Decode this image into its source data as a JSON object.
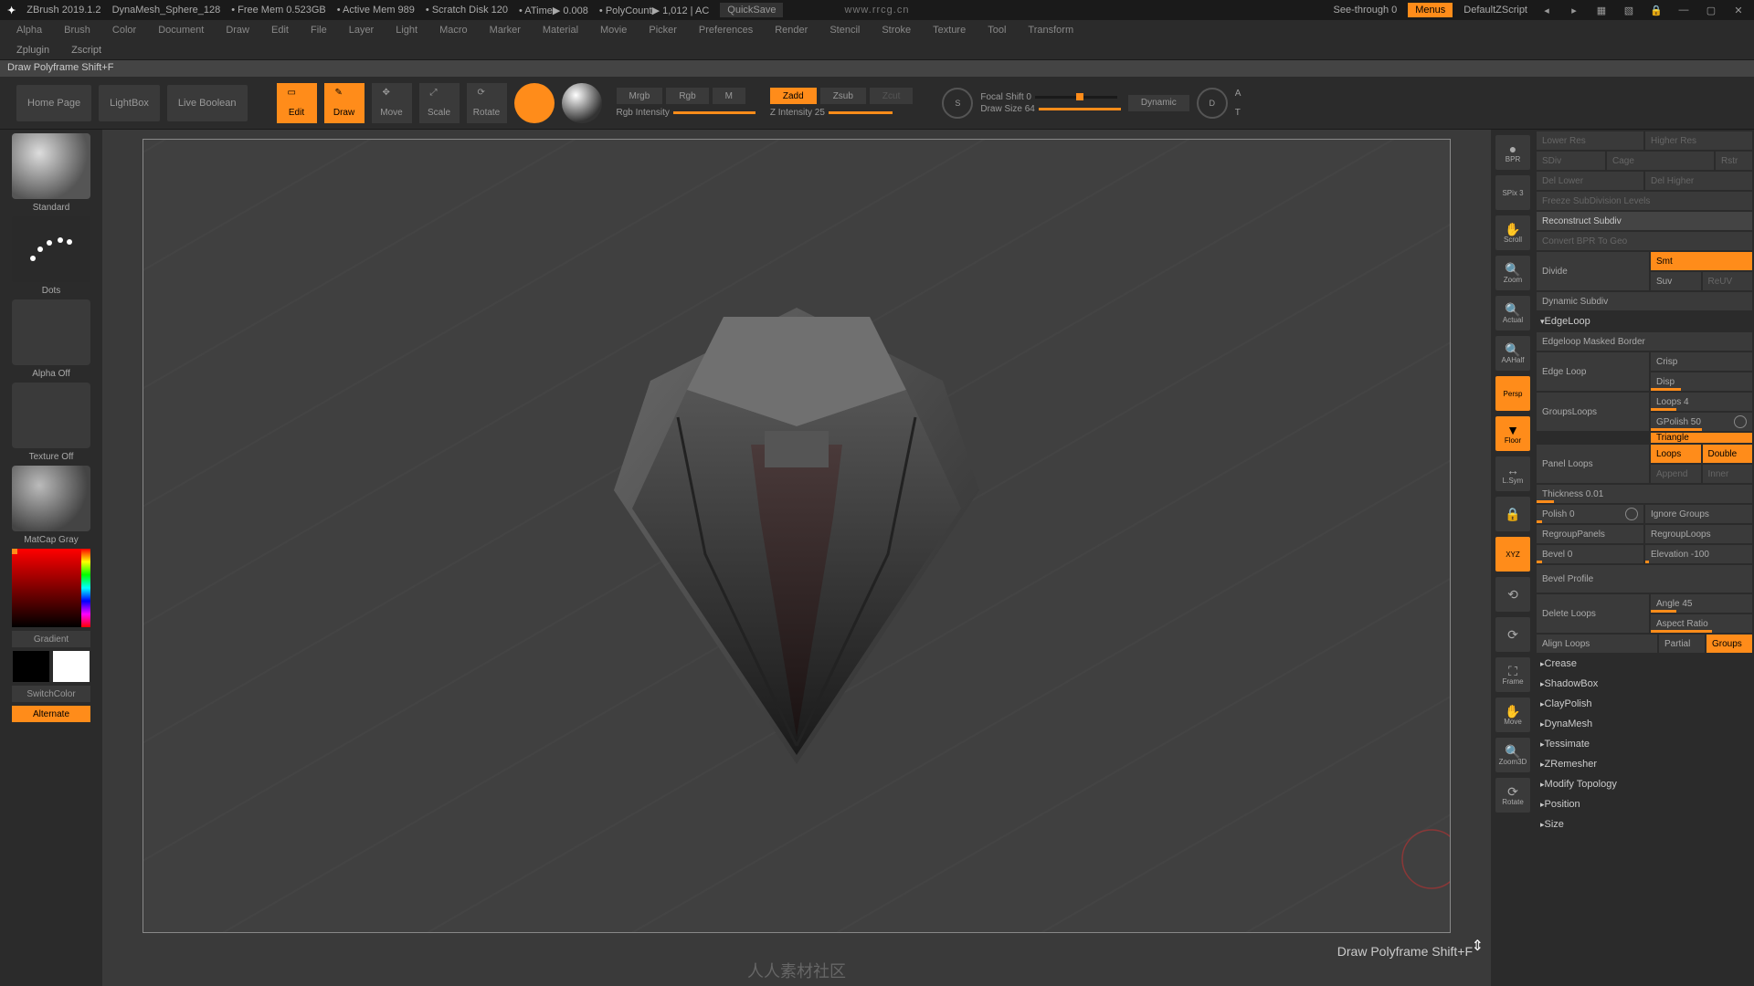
{
  "titlebar": {
    "app": "ZBrush 2019.1.2",
    "project": "DynaMesh_Sphere_128",
    "freemem": "Free Mem 0.523GB",
    "activemem": "Active Mem 989",
    "scratch": "Scratch Disk 120",
    "atime": "ATime▶ 0.008",
    "url_wm": "www.rrcg.cn",
    "polycount": "PolyCount▶ 1,012 | AC",
    "quicksave": "QuickSave",
    "seethrough": "See-through  0",
    "menus": "Menus",
    "zscript": "DefaultZScript"
  },
  "menu": {
    "items": [
      "Alpha",
      "Brush",
      "Color",
      "Document",
      "Draw",
      "Edit",
      "File",
      "Layer",
      "Light",
      "Macro",
      "Marker",
      "Material",
      "Movie",
      "Picker",
      "Preferences",
      "Render",
      "Stencil",
      "Stroke",
      "Texture",
      "Tool",
      "Transform"
    ],
    "items2": [
      "Zplugin",
      "Zscript"
    ]
  },
  "hint": "Draw Polyframe  Shift+F",
  "shelf": {
    "home": "Home Page",
    "lightbox": "LightBox",
    "liveboolean": "Live Boolean",
    "modes": [
      "Edit",
      "Draw",
      "Move",
      "Scale",
      "Rotate"
    ],
    "mrgb": "Mrgb",
    "rgb": "Rgb",
    "m": "M",
    "rgbint": "Rgb Intensity",
    "zadd": "Zadd",
    "zsub": "Zsub",
    "zcut": "Zcut",
    "zint": "Z Intensity  25",
    "focal": "Focal Shift  0",
    "drawsize": "Draw Size  64",
    "dynamic": "Dynamic",
    "a_label": "A",
    "t_label": "T",
    "s_label": "S",
    "d_label": "D"
  },
  "left": {
    "brush": "Standard",
    "stroke": "Dots",
    "alpha": "Alpha Off",
    "texture": "Texture Off",
    "material": "MatCap Gray",
    "gradient": "Gradient",
    "switch": "SwitchColor",
    "alternate": "Alternate"
  },
  "rightshelf": {
    "items": [
      {
        "label": "BPR",
        "active": false
      },
      {
        "label": "SPix 3",
        "active": false
      },
      {
        "label": "Scroll",
        "active": false
      },
      {
        "label": "Zoom",
        "active": false
      },
      {
        "label": "Actual",
        "active": false
      },
      {
        "label": "AAHalf",
        "active": false
      },
      {
        "label": "Persp",
        "active": true
      },
      {
        "label": "Floor",
        "active": true
      },
      {
        "label": "L.Sym",
        "active": false
      },
      {
        "label": "",
        "active": false
      },
      {
        "label": "XYZ",
        "active": true
      },
      {
        "label": "",
        "active": false
      },
      {
        "label": "",
        "active": false
      },
      {
        "label": "Frame",
        "active": false
      },
      {
        "label": "Move",
        "active": false
      },
      {
        "label": "Zoom3D",
        "active": false
      },
      {
        "label": "Rotate",
        "active": false
      }
    ]
  },
  "rp": {
    "lowerres": "Lower Res",
    "higherres": "Higher Res",
    "sdiv": "SDiv",
    "cage": "Cage",
    "rstr": "Rstr",
    "dellower": "Del Lower",
    "delhigher": "Del Higher",
    "freeze": "Freeze SubDivision Levels",
    "reconstruct": "Reconstruct Subdiv",
    "convert": "Convert BPR To Geo",
    "divide": "Divide",
    "smt": "Smt",
    "suv": "Suv",
    "reuv": "ReUV",
    "dynsub": "Dynamic Subdiv",
    "edgeloop_sect": "EdgeLoop",
    "edgeloop_mask": "Edgeloop Masked Border",
    "edgeloop": "Edge Loop",
    "crisp": "Crisp",
    "disp": "Disp",
    "groupsloops": "GroupsLoops",
    "loops": "Loops 4",
    "gpolish": "GPolish 50",
    "triangle": "Triangle",
    "panelloops": "Panel Loops",
    "loops2": "Loops",
    "double": "Double",
    "append": "Append",
    "inner": "Inner",
    "thickness": "Thickness 0.01",
    "polish": "Polish 0",
    "ignoregroups": "Ignore Groups",
    "regrouppanels": "RegroupPanels",
    "regrouploops": "RegroupLoops",
    "bevel": "Bevel 0",
    "elevation": "Elevation -100",
    "bevelprofile": "Bevel Profile",
    "deleteloops": "Delete Loops",
    "angle": "Angle 45",
    "aspect": "Aspect Ratio",
    "alignloops": "Align Loops",
    "partial": "Partial",
    "groups": "Groups",
    "sects": [
      "Crease",
      "ShadowBox",
      "ClayPolish",
      "DynaMesh",
      "Tessimate",
      "ZRemesher",
      "Modify Topology",
      "Position",
      "Size"
    ]
  },
  "bottom_hint": "Draw Polyframe  Shift+F",
  "logo_wm": "人人素材社区"
}
